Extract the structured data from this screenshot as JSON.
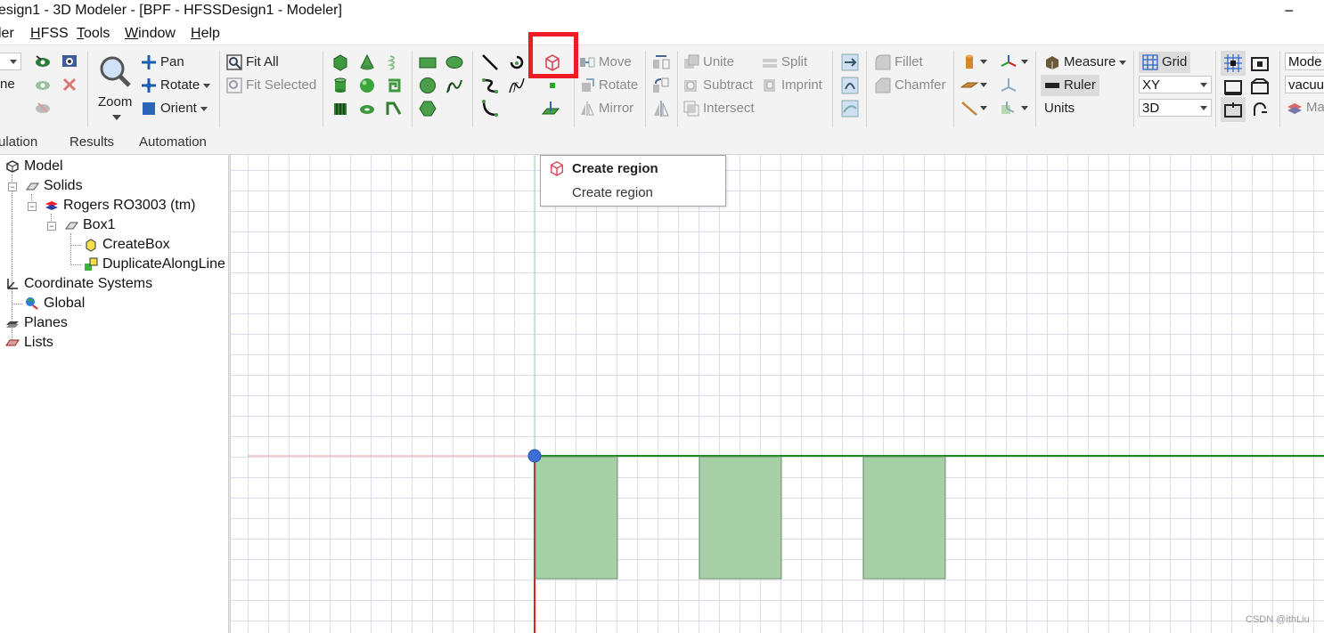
{
  "window": {
    "title": "esign1 - 3D Modeler - [BPF - HFSSDesign1 - Modeler]",
    "close_glyph": "−"
  },
  "menu": [
    {
      "label": "ler",
      "key": ""
    },
    {
      "label": "HFSS",
      "key": "H"
    },
    {
      "label": "Tools",
      "key": "T"
    },
    {
      "label": "Window",
      "key": "W"
    },
    {
      "label": "Help",
      "key": "H"
    }
  ],
  "ribbon": {
    "partial_left": "ne",
    "zoom": "Zoom",
    "pan": "Pan",
    "rotate": "Rotate",
    "orient": "Orient",
    "fit_all": "Fit All",
    "fit_selected": "Fit Selected",
    "move": "Move",
    "rotate2": "Rotate",
    "mirror": "Mirror",
    "unite": "Unite",
    "subtract": "Subtract",
    "intersect": "Intersect",
    "split": "Split",
    "imprint": "Imprint",
    "fillet": "Fillet",
    "chamfer": "Chamfer",
    "measure": "Measure",
    "ruler": "Ruler",
    "units": "Units",
    "grid": "Grid",
    "plane_value": "XY",
    "dim_value": "3D",
    "model_value": "Mode",
    "material_value": "vacuu",
    "partial_ma": "Ma"
  },
  "tabs": [
    "ulation",
    "Results",
    "Automation"
  ],
  "tree": {
    "model": "Model",
    "solids": "Solids",
    "material": "Rogers RO3003 (tm)",
    "box1": "Box1",
    "create_box": "CreateBox",
    "duplicate": "DuplicateAlongLine",
    "coord_systems": "Coordinate Systems",
    "global": "Global",
    "planes": "Planes",
    "lists": "Lists"
  },
  "tooltip": {
    "title": "Create region",
    "description": "Create region"
  },
  "watermark": "CSDN @ithLiu",
  "colors": {
    "highlight": "#ee1c25",
    "box_fill": "#a6cfa6",
    "x_axis": "#1a8a1a",
    "y_axis": "#e02020",
    "origin": "#3a6fd8"
  }
}
